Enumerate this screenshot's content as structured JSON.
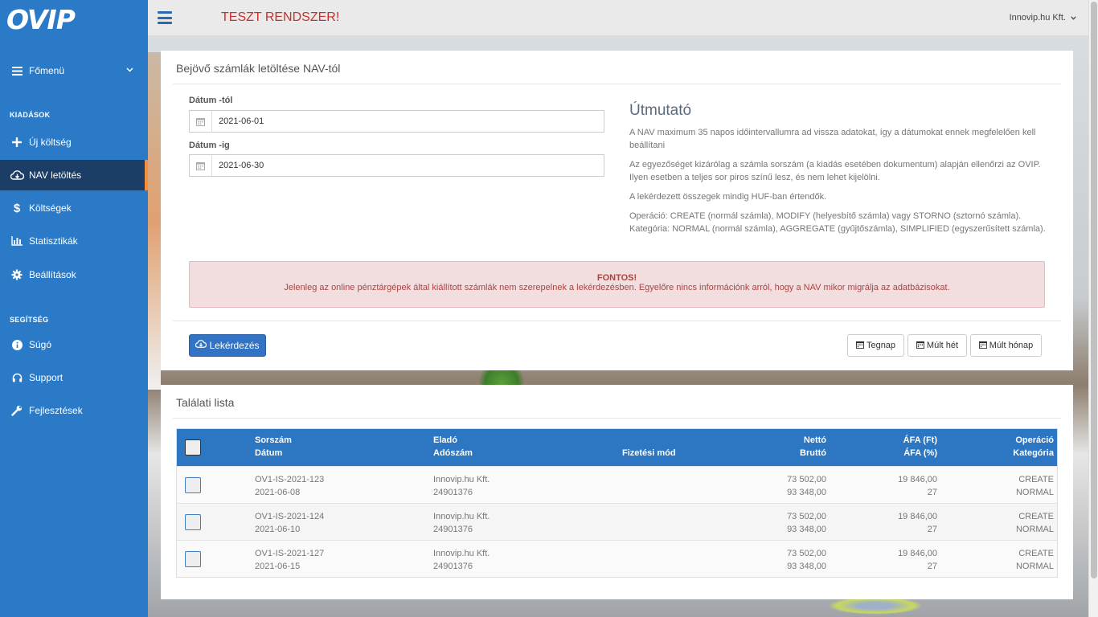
{
  "logo": "OVIP",
  "sidebar": {
    "main_menu": "Főmenü",
    "section_expenses": "KIADÁSOK",
    "items": [
      {
        "label": "Új költség",
        "icon": "plus-icon"
      },
      {
        "label": "NAV letöltés",
        "icon": "cloud-download-icon",
        "active": true
      },
      {
        "label": "Költségek",
        "icon": "dollar-icon"
      },
      {
        "label": "Statisztikák",
        "icon": "bar-chart-icon"
      },
      {
        "label": "Beállítások",
        "icon": "gear-icon"
      }
    ],
    "section_help": "SEGÍTSÉG",
    "help_items": [
      {
        "label": "Súgó",
        "icon": "info-icon"
      },
      {
        "label": "Support",
        "icon": "headset-icon"
      },
      {
        "label": "Fejlesztések",
        "icon": "wrench-icon"
      }
    ]
  },
  "topbar": {
    "system_title": "TESZT RENDSZER!",
    "company": "Innovip.hu Kft."
  },
  "download_panel": {
    "title": "Bejövő számlák letöltése NAV-tól",
    "date_from_label": "Dátum -tól",
    "date_from_value": "2021-06-01",
    "date_to_label": "Dátum -ig",
    "date_to_value": "2021-06-30",
    "guide_title": "Útmutató",
    "guide_p1": "A NAV maximum 35 napos időintervallumra ad vissza adatokat, így a dátumokat ennek megfelelően kell beállítani",
    "guide_p2": "Az egyezőséget kizárólag a számla sorszám (a kiadás esetében dokumentum) alapján ellenőrzi az OVIP. Ilyen esetben a teljes sor piros színű lesz, és nem lehet kijelölni.",
    "guide_p3": "A lekérdezett összegek mindig HUF-ban értendők.",
    "guide_p4": "Operáció: CREATE (normál számla), MODIFY (helyesbítő számla) vagy STORNO (sztornó számla). Kategória: NORMAL (normál számla), AGGREGATE (gyűjtőszámla), SIMPLIFIED (egyszerűsített számla).",
    "alert_title": "FONTOS!",
    "alert_text": "Jelenleg az online pénztárgépek által kiállított számlák nem szerepelnek a lekérdezésben. Egyelőre nincs információnk arról, hogy a NAV mikor migrálja az adatbázisokat.",
    "query_button": "Lekérdezés",
    "btn_yesterday": "Tegnap",
    "btn_last_week": "Múlt hét",
    "btn_last_month": "Múlt hónap"
  },
  "results_panel": {
    "title": "Találati lista",
    "headers": {
      "serial": "Sorszám",
      "date": "Dátum",
      "seller": "Eladó",
      "tax_no": "Adószám",
      "payment": "Fizetési mód",
      "net": "Nettó",
      "gross": "Bruttó",
      "vat_ft": "ÁFA (Ft)",
      "vat_pct": "ÁFA (%)",
      "operation": "Operáció",
      "category": "Kategória"
    },
    "rows": [
      {
        "serial": "OV1-IS-2021-123",
        "date": "2021-06-08",
        "seller": "Innovip.hu Kft.",
        "tax_no": "24901376",
        "payment": "",
        "net": "73 502,00",
        "gross": "93 348,00",
        "vat_ft": "19 846,00",
        "vat_pct": "27",
        "operation": "CREATE",
        "category": "NORMAL"
      },
      {
        "serial": "OV1-IS-2021-124",
        "date": "2021-06-10",
        "seller": "Innovip.hu Kft.",
        "tax_no": "24901376",
        "payment": "",
        "net": "73 502,00",
        "gross": "93 348,00",
        "vat_ft": "19 846,00",
        "vat_pct": "27",
        "operation": "CREATE",
        "category": "NORMAL"
      },
      {
        "serial": "OV1-IS-2021-127",
        "date": "2021-06-15",
        "seller": "Innovip.hu Kft.",
        "tax_no": "24901376",
        "payment": "",
        "net": "73 502,00",
        "gross": "93 348,00",
        "vat_ft": "19 846,00",
        "vat_pct": "27",
        "operation": "CREATE",
        "category": "NORMAL"
      }
    ]
  },
  "colors": {
    "sidebar": "#2a7ac8",
    "sidebar_active": "#1b3d66",
    "active_accent": "#f3903f",
    "table_header": "#2d76c2",
    "alert_bg": "#f2dede",
    "alert_text": "#a94442",
    "test_title": "#c9302c"
  }
}
